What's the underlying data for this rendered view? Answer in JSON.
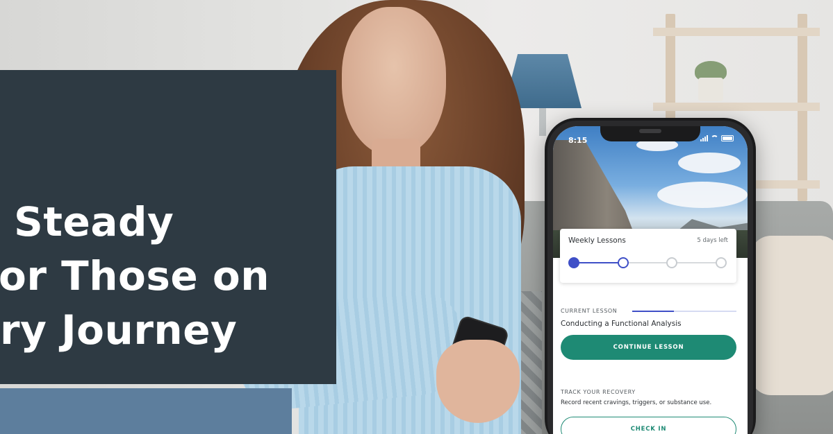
{
  "headline": {
    "line1": "Steady",
    "line2": "or Those on",
    "line3": "ry Journey"
  },
  "phone": {
    "status_time": "8:15",
    "weekly_card": {
      "title": "Weekly Lessons",
      "days_left": "5 days left",
      "steps_total": 4,
      "steps_completed": 1,
      "current_step": 2
    },
    "current_lesson": {
      "label": "CURRENT LESSON",
      "progress": 0.4,
      "title": "Conducting a Functional Analysis",
      "button": "CONTINUE LESSON"
    },
    "track_recovery": {
      "label": "TRACK YOUR RECOVERY",
      "description": "Record recent cravings, triggers, or substance use.",
      "button": "CHECK IN"
    }
  },
  "colors": {
    "panel": "#2e3a43",
    "accent_green": "#1e8a74",
    "accent_blue": "#3f4fc7"
  },
  "icons": [
    "signal-icon",
    "wifi-icon",
    "battery-icon"
  ]
}
